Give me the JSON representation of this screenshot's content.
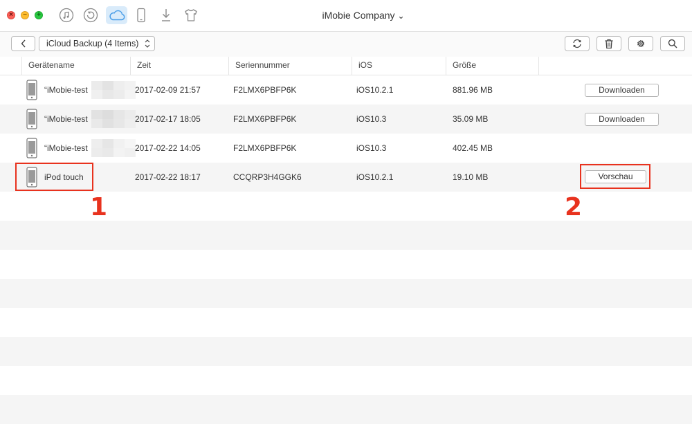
{
  "window": {
    "title": "iMobie Company",
    "title_chevron": "⌄",
    "controls": {
      "close": "×",
      "minimize": "−",
      "maximize": "+"
    }
  },
  "nav": {
    "icons": [
      "music-icon",
      "restore-icon",
      "icloud-icon",
      "device-icon",
      "download-icon",
      "shirt-icon"
    ],
    "active": "icloud-icon"
  },
  "toolbar": {
    "source_label": "iCloud Backup (4 Items)",
    "buttons": [
      "back-icon",
      "refresh-icon",
      "trash-icon",
      "gear-icon",
      "search-icon"
    ]
  },
  "table": {
    "columns": [
      "Gerätename",
      "Zeit",
      "Seriennummer",
      "iOS",
      "Größe"
    ],
    "rows": [
      {
        "name": "“iMobie-test",
        "time": "2017-02-09 21:57",
        "serial": "F2LMX6PBFP6K",
        "ios": "iOS10.2.1",
        "size": "881.96 MB",
        "action": "Downloaden"
      },
      {
        "name": "“iMobie-test",
        "time": "2017-02-17 18:05",
        "serial": "F2LMX6PBFP6K",
        "ios": "iOS10.3",
        "size": "35.09 MB",
        "action": "Downloaden"
      },
      {
        "name": "“iMobie-test",
        "time": "2017-02-22 14:05",
        "serial": "F2LMX6PBFP6K",
        "ios": "iOS10.3",
        "size": "402.45 MB",
        "action": ""
      },
      {
        "name": "iPod touch",
        "time": "2017-02-22 18:17",
        "serial": "CCQRP3H4GGK6",
        "ios": "iOS10.2.1",
        "size": "19.10 MB",
        "action": "Vorschau"
      }
    ]
  },
  "annotations": {
    "first": "1",
    "second": "2"
  },
  "colors": {
    "accent": "#4a9ee8",
    "annotation": "#e8321e",
    "alt_row": "#f5f5f5"
  }
}
